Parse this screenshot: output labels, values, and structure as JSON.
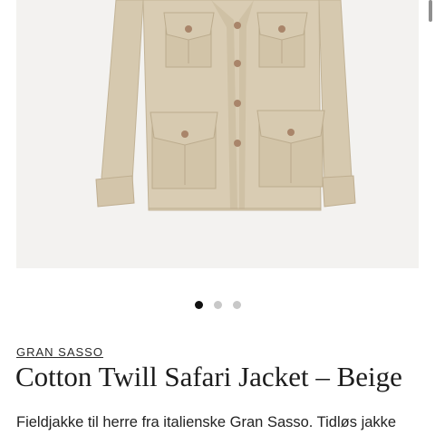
{
  "product": {
    "image_alt": "Cotton Twill Safari Jacket – Beige",
    "carousel": {
      "total": 3,
      "active": 0
    },
    "brand": "GRAN SASSO",
    "title": "Cotton Twill Safari Jacket – Beige",
    "description": "Fieldjakke til herre fra italienske Gran Sasso. Tidløs jakke"
  },
  "colors": {
    "jacket": "#d9ccb3",
    "jacket_shadow": "#c7b89b",
    "buttons": "#a9856a",
    "image_bg": "#f3f2f0",
    "dot_active": "#111111",
    "dot_inactive": "#c8c8c8"
  }
}
